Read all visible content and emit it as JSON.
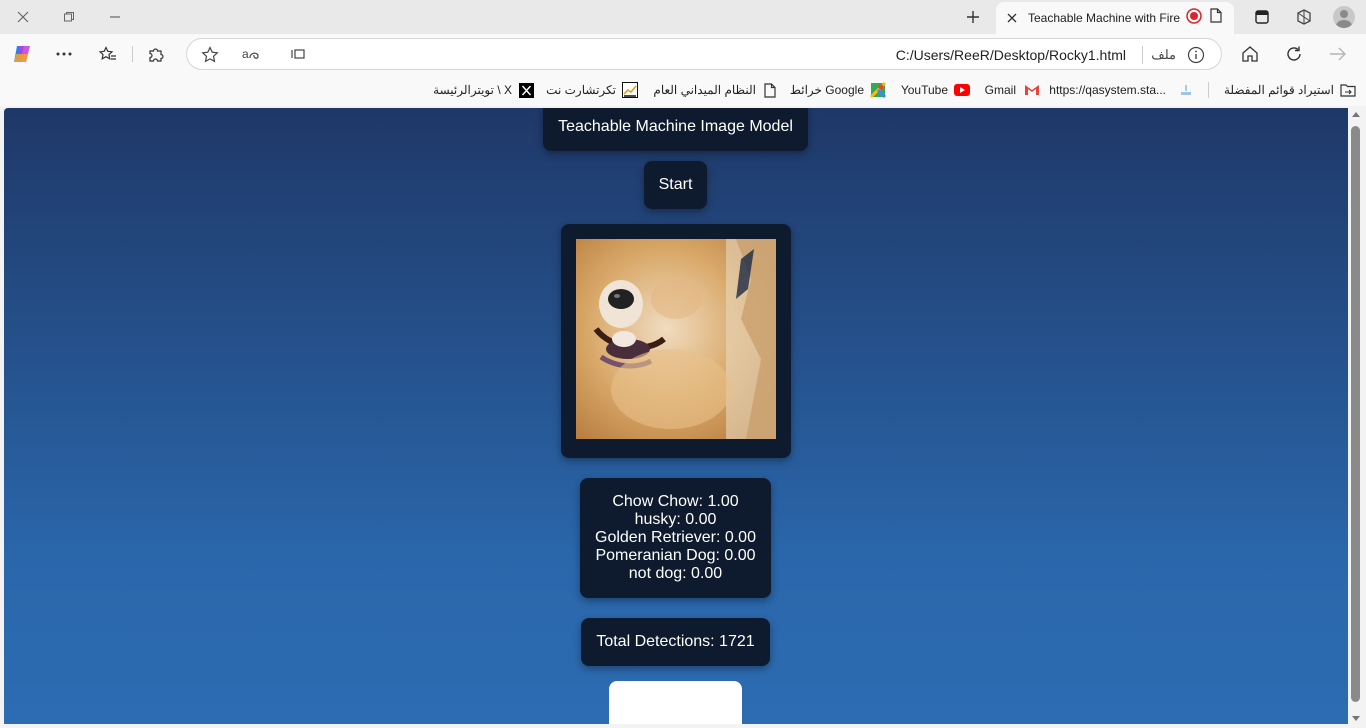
{
  "browser": {
    "tab": {
      "title": "Teachable Machine with Fire"
    },
    "address": {
      "url": "C:/Users/ReeR/Desktop/Rocky1.html",
      "scheme_label": "ملف"
    },
    "bookmarks": [
      {
        "label": "استيراد قوائم المفضلة",
        "icon": "folder-import-icon"
      },
      {
        "label": "https://qasystem.sta...",
        "icon": "site-icon"
      },
      {
        "label": "Gmail",
        "icon": "gmail-icon"
      },
      {
        "label": "YouTube",
        "icon": "youtube-icon"
      },
      {
        "label": "خرائط Google",
        "icon": "maps-icon"
      },
      {
        "label": "النظام الميداني العام",
        "icon": "page-icon"
      },
      {
        "label": "تكرتشارت نت",
        "icon": "chart-icon"
      },
      {
        "label": "تويترالرئيسة \\ X",
        "icon": "x-icon"
      }
    ]
  },
  "page": {
    "title": "Teachable Machine Image Model",
    "start_label": "Start",
    "predictions": [
      {
        "label": "Chow Chow: 1.00"
      },
      {
        "label": "husky: 0.00"
      },
      {
        "label": "Golden Retriever: 0.00"
      },
      {
        "label": "Pomeranian Dog: 0.00"
      },
      {
        "label": "not dog: 0.00"
      }
    ],
    "total_detections": "Total Detections: 1721"
  },
  "colors": {
    "gradient_top": "#1f3868",
    "gradient_bottom": "#2d6cb2",
    "card_bg": "#0e1b2e",
    "record_red": "#d9232d"
  }
}
